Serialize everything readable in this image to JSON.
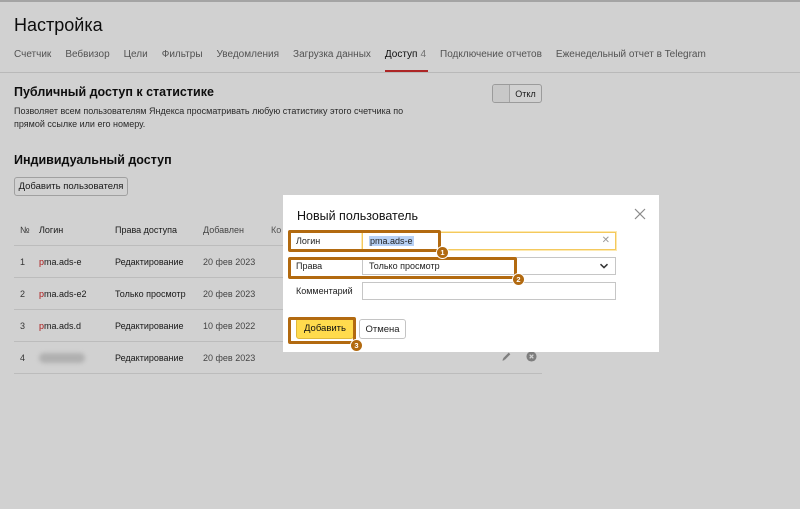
{
  "page": {
    "title": "Настройка"
  },
  "tabs": [
    {
      "label": "Счетчик"
    },
    {
      "label": "Вебвизор"
    },
    {
      "label": "Цели"
    },
    {
      "label": "Фильтры"
    },
    {
      "label": "Уведомления"
    },
    {
      "label": "Загрузка данных"
    },
    {
      "label": "Доступ",
      "count": "4"
    },
    {
      "label": "Подключение отчетов"
    },
    {
      "label": "Еженедельный отчет в Telegram"
    }
  ],
  "public_access": {
    "title": "Публичный доступ к статистике",
    "description": "Позволяет всем пользователям Яндекса просматривать любую статистику этого счетчика по прямой ссылке или его номеру.",
    "toggle_label": "Откл"
  },
  "individual_access": {
    "title": "Индивидуальный доступ",
    "add_button": "Добавить пользователя",
    "columns": {
      "num": "№",
      "login": "Логин",
      "rights": "Права доступа",
      "added": "Добавлен",
      "comment": "Ко"
    },
    "rows": [
      {
        "num": "1",
        "login_first": "p",
        "login_rest": "ma.ads-e",
        "rights": "Редактирование",
        "added": "20 фев 2023"
      },
      {
        "num": "2",
        "login_first": "p",
        "login_rest": "ma.ads-e2",
        "rights": "Только просмотр",
        "added": "20 фев 2023"
      },
      {
        "num": "3",
        "login_first": "p",
        "login_rest": "ma.ads.d",
        "rights": "Редактирование",
        "added": "10 фев 2022"
      },
      {
        "num": "4",
        "login_first": "",
        "login_rest": "",
        "rights": "Редактирование",
        "added": "20 фев 2023"
      }
    ]
  },
  "modal": {
    "title": "Новый пользователь",
    "login_label": "Логин",
    "login_value": "pma.ads-e",
    "rights_label": "Права",
    "rights_value": "Только просмотр",
    "comment_label": "Комментарий",
    "comment_value": "",
    "submit": "Добавить",
    "cancel": "Отмена"
  },
  "annotations": [
    "1",
    "2",
    "3"
  ],
  "colors": {
    "accent": "#ffdb4d",
    "highlight": "#b26a10",
    "active_tab": "#d32f2f",
    "login_first_char": "#d01a1a"
  }
}
